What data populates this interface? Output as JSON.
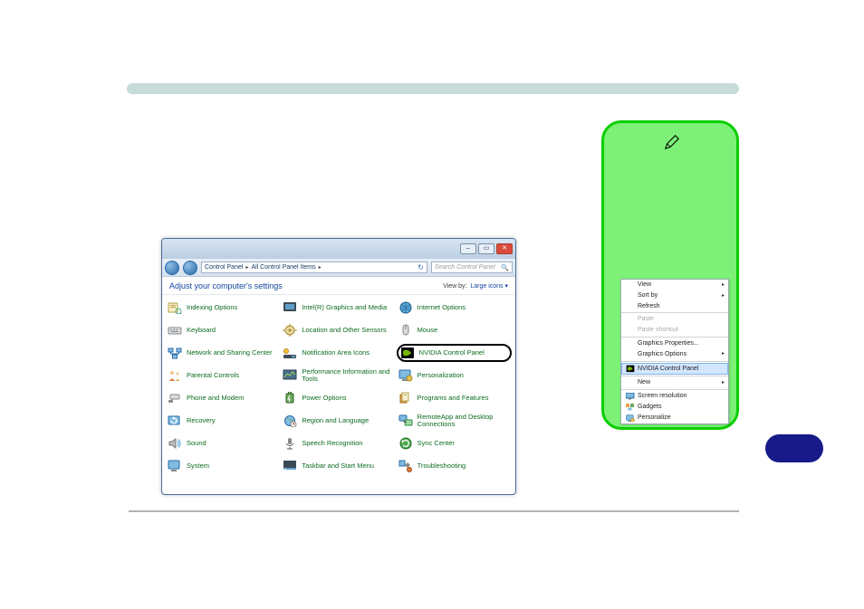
{
  "accent": {
    "color": "#c7dbd9"
  },
  "note": {
    "pen_icon": "pen-icon"
  },
  "context_menu": {
    "items": [
      {
        "label": "View",
        "arrow": true
      },
      {
        "label": "Sort by",
        "arrow": true
      },
      {
        "label": "Refresh"
      },
      {
        "sep": true
      },
      {
        "label": "Paste",
        "disabled": true
      },
      {
        "label": "Paste shortcut",
        "disabled": true
      },
      {
        "sep": true
      },
      {
        "label": "Graphics Properties..."
      },
      {
        "label": "Graphics Options",
        "arrow": true
      },
      {
        "sep": true
      },
      {
        "label": "NVIDIA Control Panel",
        "icon": "nvidia",
        "highlight": true
      },
      {
        "sep": true
      },
      {
        "label": "New",
        "arrow": true
      },
      {
        "sep": true
      },
      {
        "label": "Screen resolution",
        "icon": "screen"
      },
      {
        "label": "Gadgets",
        "icon": "gadget"
      },
      {
        "label": "Personalize",
        "icon": "personalize"
      }
    ]
  },
  "window": {
    "titlebar": {
      "min": "–",
      "max": "▭",
      "close": "✕"
    },
    "breadcrumb": {
      "root": "Control Panel",
      "child": "All Control Panel Items"
    },
    "search_placeholder": "Search Control Panel",
    "header": {
      "title": "Adjust your computer's settings",
      "viewby_label": "View by:",
      "viewby_value": "Large icons ▾"
    },
    "items": [
      {
        "label": "Indexing Options",
        "icon": "index"
      },
      {
        "label": "Intel(R) Graphics and Media",
        "icon": "intel"
      },
      {
        "label": "Internet Options",
        "icon": "globe"
      },
      {
        "label": "Keyboard",
        "icon": "keyboard"
      },
      {
        "label": "Location and Other Sensors",
        "icon": "location"
      },
      {
        "label": "Mouse",
        "icon": "mouse"
      },
      {
        "label": "Network and Sharing Center",
        "icon": "network"
      },
      {
        "label": "Notification Area Icons",
        "icon": "notify"
      },
      {
        "label": "NVIDIA Control Panel",
        "icon": "nvidia",
        "highlight": true
      },
      {
        "label": "Parental Controls",
        "icon": "parental"
      },
      {
        "label": "Performance Information and Tools",
        "icon": "perf"
      },
      {
        "label": "Personalization",
        "icon": "personalize"
      },
      {
        "label": "Phone and Modem",
        "icon": "phone"
      },
      {
        "label": "Power Options",
        "icon": "power"
      },
      {
        "label": "Programs and Features",
        "icon": "programs"
      },
      {
        "label": "Recovery",
        "icon": "recovery"
      },
      {
        "label": "Region and Language",
        "icon": "region"
      },
      {
        "label": "RemoteApp and Desktop Connections",
        "icon": "remote"
      },
      {
        "label": "Sound",
        "icon": "sound"
      },
      {
        "label": "Speech Recognition",
        "icon": "speech"
      },
      {
        "label": "Sync Center",
        "icon": "sync"
      },
      {
        "label": "System",
        "icon": "system"
      },
      {
        "label": "Taskbar and Start Menu",
        "icon": "taskbar"
      },
      {
        "label": "Troubleshooting",
        "icon": "trouble"
      }
    ]
  }
}
